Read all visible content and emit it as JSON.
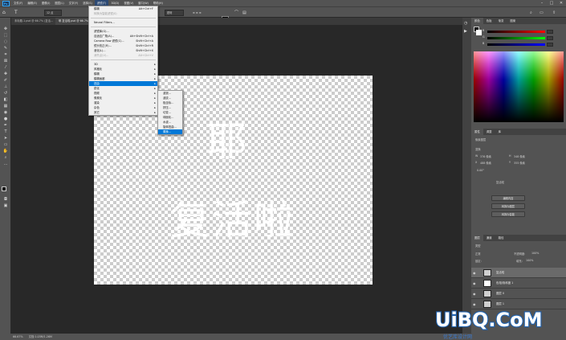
{
  "menubar": {
    "logo": "Ps",
    "items": [
      "文件(F)",
      "编辑(E)",
      "图像(I)",
      "图层(L)",
      "文字(Y)",
      "选择(S)",
      "滤镜(T)",
      "3D(D)",
      "视图(V)",
      "窗口(W)",
      "帮助(H)"
    ],
    "active_index": 6
  },
  "optbar": {
    "font_size": "12 点",
    "antialias": "锐利",
    "align_icons": "≡ ≡ ≡"
  },
  "tabs": [
    {
      "label": "未标题-1.psd @ 66.7% (复活...",
      "active": false
    },
    {
      "label": "耶 复活啦.psd @ 66.7% (复活啦, RGB/8) *",
      "active": true
    }
  ],
  "canvas": {
    "line1": "耶",
    "line2": "复活啦"
  },
  "status": {
    "zoom": "66.67%",
    "doc": "文档:1.03M/1.26M"
  },
  "filter_menu": [
    {
      "label": "模糊",
      "shortcut": "Alt+Ctrl+F",
      "disabled": false
    },
    {
      "label": "转换为智能滤镜(S)",
      "shortcut": "",
      "disabled": true
    },
    {
      "sep": true
    },
    {
      "label": "Neural Filters...",
      "shortcut": "",
      "disabled": false
    },
    {
      "sep": true
    },
    {
      "label": "滤镜库(G)...",
      "shortcut": "",
      "disabled": false
    },
    {
      "label": "自适应广角(A)...",
      "shortcut": "Alt+Shift+Ctrl+A",
      "disabled": false
    },
    {
      "label": "Camera Raw 滤镜(C)...",
      "shortcut": "Shift+Ctrl+A",
      "disabled": false
    },
    {
      "label": "镜头校正(R)...",
      "shortcut": "Shift+Ctrl+R",
      "disabled": false
    },
    {
      "label": "液化(L)...",
      "shortcut": "Shift+Ctrl+X",
      "disabled": false
    },
    {
      "label": "消失点(V)...",
      "shortcut": "Alt+Ctrl+V",
      "disabled": true
    },
    {
      "sep": true
    },
    {
      "label": "3D",
      "sub": true
    },
    {
      "label": "风格化",
      "sub": true
    },
    {
      "label": "模糊",
      "sub": true
    },
    {
      "label": "模糊画廊",
      "sub": true
    },
    {
      "label": "扭曲",
      "sub": true,
      "highlight": true
    },
    {
      "label": "锐化",
      "sub": true
    },
    {
      "label": "视频",
      "sub": true
    },
    {
      "label": "像素化",
      "sub": true
    },
    {
      "label": "渲染",
      "sub": true
    },
    {
      "label": "杂色",
      "sub": true
    },
    {
      "label": "其它",
      "sub": true
    }
  ],
  "distort_submenu": [
    {
      "label": "波浪..."
    },
    {
      "label": "波纹..."
    },
    {
      "label": "极坐标..."
    },
    {
      "label": "挤压..."
    },
    {
      "label": "切变..."
    },
    {
      "label": "球面化..."
    },
    {
      "label": "水波..."
    },
    {
      "label": "旋转扭曲..."
    },
    {
      "label": "置换...",
      "highlight": true
    }
  ],
  "color_panel": {
    "tabs": [
      "颜色",
      "色板",
      "渐变",
      "图案"
    ],
    "sliders": [
      {
        "label": "R",
        "color": "#e02020"
      },
      {
        "label": "G",
        "color": "#20c020"
      },
      {
        "label": "B",
        "color": "#2040e0"
      }
    ]
  },
  "properties_panel": {
    "tabs": [
      "属性",
      "调整",
      "库"
    ],
    "kind": "像素图层",
    "transform_label": "变换",
    "w_label": "W",
    "w_val": "376 像素",
    "h_label": "H",
    "h_val": "348 像素",
    "x_label": "X",
    "x_val": "488 像素",
    "y_label": "Y",
    "y_val": "355 像素",
    "angle": "0.00°",
    "layer_name": "复活啦",
    "btn1": "编辑内容",
    "btn2": "转换为图层",
    "btn3": "转换为智能"
  },
  "layers_panel": {
    "tabs": [
      "图层",
      "通道",
      "路径"
    ],
    "kind_filter": "类型",
    "blend": "正常",
    "opacity_label": "不透明度:",
    "opacity": "100%",
    "lock_label": "锁定:",
    "fill_label": "填充:",
    "fill": "100%",
    "layers": [
      {
        "name": "复活啦",
        "selected": true
      },
      {
        "name": "色相/饱和度 1",
        "selected": false
      },
      {
        "name": "图层 0",
        "selected": false
      },
      {
        "name": "图层 1",
        "selected": false
      }
    ]
  },
  "watermark": {
    "brand": "UiBQ.CoM",
    "tagline": "优艺库设计网"
  }
}
